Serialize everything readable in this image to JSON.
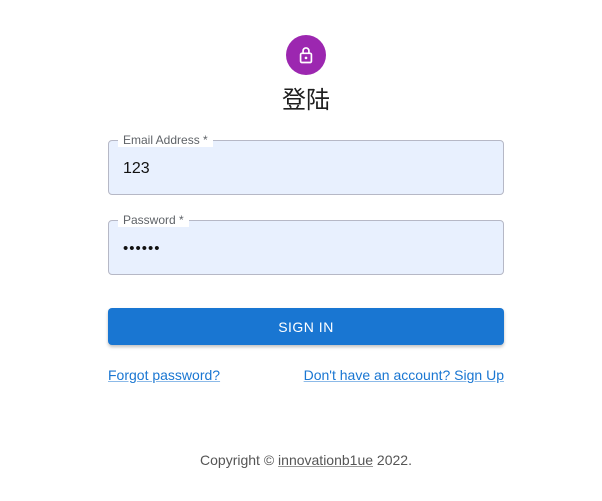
{
  "header": {
    "icon": "lock-icon",
    "avatar_color": "#9c27b0",
    "title": "登陆"
  },
  "form": {
    "email": {
      "label": "Email Address *",
      "value": "123"
    },
    "password": {
      "label": "Password *",
      "value": "••••••"
    },
    "submit_label": "SIGN IN",
    "accent_color": "#1976d2"
  },
  "links": {
    "forgot": "Forgot password?",
    "signup": "Don't have an account? Sign Up"
  },
  "footer": {
    "prefix": "Copyright © ",
    "brand": "innovationb1ue",
    "suffix": " 2022."
  }
}
